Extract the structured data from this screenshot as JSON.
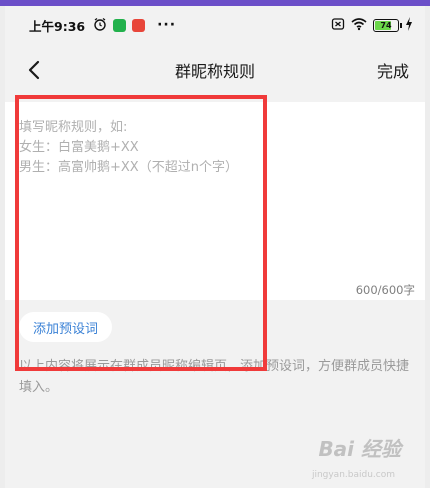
{
  "status_bar": {
    "time": "上午9:36",
    "more": "···",
    "battery_level": "74",
    "battery_fraction": 0.74
  },
  "header": {
    "title": "群昵称规则",
    "done_label": "完成"
  },
  "rule_editor": {
    "placeholder": "填写昵称规则，如:\n女生：白富美鹅+XX\n男生：高富帅鹅+XX（不超过n个字）",
    "value": "",
    "char_count": "600/600字"
  },
  "preset": {
    "label": "添加预设词"
  },
  "hint": {
    "text": "以上内容将展示在群成员昵称编辑页，添加预设词，方便群成员快捷填入。"
  },
  "watermark": {
    "logo": "Bai 经验",
    "sub": "jingyan.baidu.com"
  },
  "colors": {
    "accent_blue": "#3b82d6",
    "highlight_red": "#f03a3a",
    "top_strip": "#6b4fc8",
    "battery_green": "#6bd64a"
  },
  "icons": {
    "back": "chevron-left-icon",
    "alarm": "alarm-clock-icon",
    "wifi": "wifi-icon",
    "battery": "battery-icon",
    "charging": "lightning-icon",
    "sim": "sim-off-icon"
  }
}
